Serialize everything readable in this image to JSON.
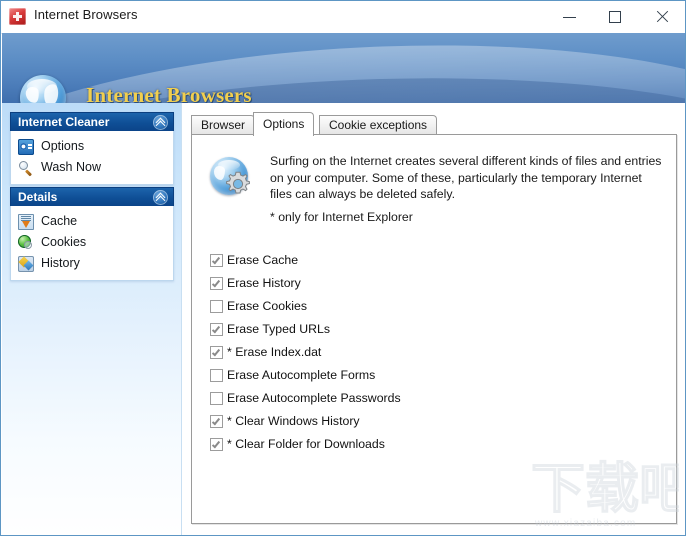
{
  "window": {
    "title": "Internet Browsers",
    "app_icon": "app-icon",
    "controls": {
      "minimize": "—",
      "maximize": "□",
      "close": "✕"
    }
  },
  "banner": {
    "title": "Internet Browsers",
    "icon": "globe-icon",
    "title_color": "#f2cf4e",
    "background_color": "#4e7fbb"
  },
  "sidebar": {
    "panels": [
      {
        "title": "Internet Cleaner",
        "collapse_icon": "chevron-double-up-icon",
        "items": [
          {
            "label": "Options",
            "icon": "options-icon"
          },
          {
            "label": "Wash Now",
            "icon": "magnifier-icon"
          }
        ]
      },
      {
        "title": "Details",
        "collapse_icon": "chevron-double-up-icon",
        "items": [
          {
            "label": "Cache",
            "icon": "cache-icon"
          },
          {
            "label": "Cookies",
            "icon": "cookies-icon"
          },
          {
            "label": "History",
            "icon": "history-icon"
          }
        ]
      }
    ],
    "header_color": "#0f4f96"
  },
  "content": {
    "tabs": [
      {
        "label": "Browser",
        "active": false
      },
      {
        "label": "Options",
        "active": true
      },
      {
        "label": "Cookie exceptions",
        "active": false
      }
    ],
    "info": {
      "icon": "globe-gear-icon",
      "description": "Surfing on the Internet creates several different kinds of files and entries on your computer. Some of these, particularly the temporary Internet files can always be deleted safely.",
      "note": "*  only for Internet Explorer"
    },
    "options": [
      {
        "label": "Erase Cache",
        "checked": true
      },
      {
        "label": "Erase History",
        "checked": true
      },
      {
        "label": "Erase Cookies",
        "checked": false
      },
      {
        "label": "Erase Typed URLs",
        "checked": true
      },
      {
        "label": "* Erase Index.dat",
        "checked": true
      },
      {
        "label": "Erase Autocomplete Forms",
        "checked": false
      },
      {
        "label": "Erase Autocomplete Passwords",
        "checked": false
      },
      {
        "label": "* Clear Windows History",
        "checked": true
      },
      {
        "label": "* Clear Folder for Downloads",
        "checked": true
      }
    ]
  },
  "watermark": {
    "text": "下载吧",
    "url": "www.xiazaiba.com"
  }
}
